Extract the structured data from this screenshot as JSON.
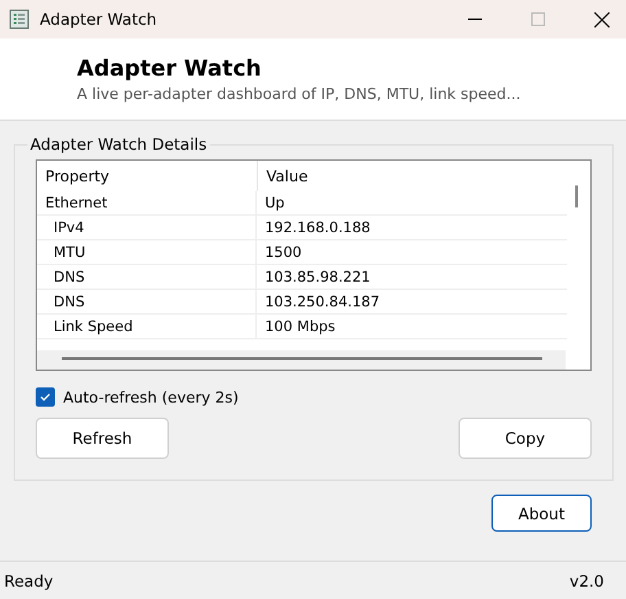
{
  "window": {
    "title": "Adapter Watch"
  },
  "header": {
    "title": "Adapter Watch",
    "subtitle": "A live per-adapter dashboard of IP, DNS, MTU, link speed..."
  },
  "group": {
    "title": "Adapter Watch Details"
  },
  "table": {
    "columns": [
      "Property",
      "Value"
    ],
    "rows": [
      {
        "property": "Ethernet",
        "value": "Up",
        "children": [
          {
            "property": "IPv4",
            "value": "192.168.0.188"
          },
          {
            "property": "MTU",
            "value": "1500"
          },
          {
            "property": "DNS",
            "value": "103.85.98.221"
          },
          {
            "property": "DNS",
            "value": "103.250.84.187"
          },
          {
            "property": "Link Speed",
            "value": "100 Mbps"
          }
        ]
      }
    ]
  },
  "auto_refresh": {
    "label": "Auto-refresh (every 2s)",
    "checked": true
  },
  "buttons": [
    "Refresh",
    "Copy"
  ],
  "about_button": "About",
  "status_bar": {
    "status": "Ready",
    "version": "v2.0"
  }
}
